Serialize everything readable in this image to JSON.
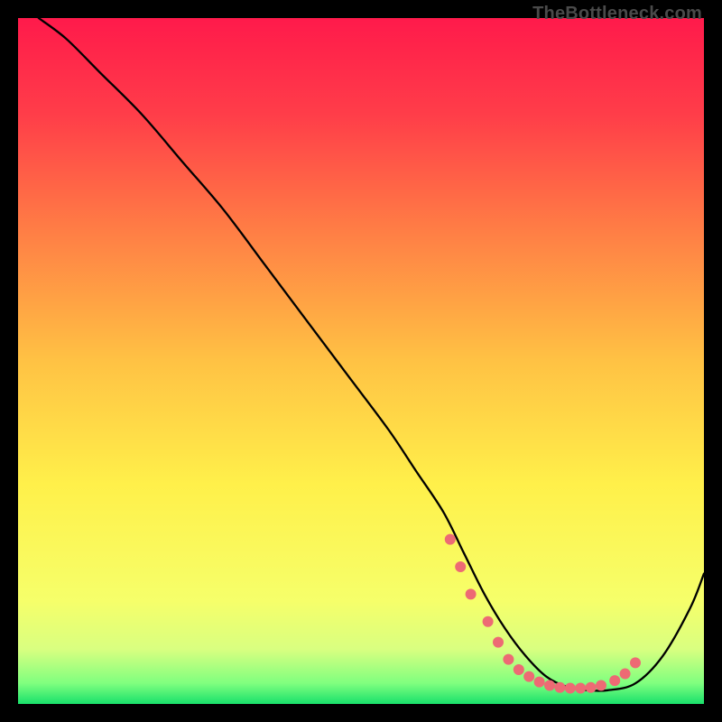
{
  "watermark": "TheBottleneck.com",
  "chart_data": {
    "type": "line",
    "title": "",
    "xlabel": "",
    "ylabel": "",
    "xlim": [
      0,
      100
    ],
    "ylim": [
      0,
      100
    ],
    "grid": false,
    "legend": false,
    "annotations": [],
    "gradient_stops": [
      {
        "pct": 0,
        "color": "#ff1a4b"
      },
      {
        "pct": 14,
        "color": "#ff3d49"
      },
      {
        "pct": 30,
        "color": "#ff7a45"
      },
      {
        "pct": 50,
        "color": "#ffc244"
      },
      {
        "pct": 68,
        "color": "#fff04a"
      },
      {
        "pct": 85,
        "color": "#f6ff6a"
      },
      {
        "pct": 92,
        "color": "#d9ff80"
      },
      {
        "pct": 97,
        "color": "#7fff7f"
      },
      {
        "pct": 100,
        "color": "#19e06b"
      }
    ],
    "series": [
      {
        "name": "bottleneck-curve",
        "color": "#000000",
        "width": 2.3,
        "x": [
          3,
          7,
          12,
          18,
          24,
          30,
          36,
          42,
          48,
          54,
          58,
          62,
          65,
          68,
          71,
          74,
          77,
          80,
          83,
          86,
          90,
          94,
          98,
          100
        ],
        "y": [
          100,
          97,
          92,
          86,
          79,
          72,
          64,
          56,
          48,
          40,
          34,
          28,
          22,
          16,
          11,
          7,
          4,
          2.5,
          2,
          2,
          3,
          7,
          14,
          19
        ]
      },
      {
        "name": "valley-dots",
        "color": "#ed6a74",
        "type": "scatter",
        "marker_size": 6,
        "x": [
          63,
          64.5,
          66,
          68.5,
          70,
          71.5,
          73,
          74.5,
          76,
          77.5,
          79,
          80.5,
          82,
          83.5,
          85,
          87,
          88.5,
          90
        ],
        "y": [
          24,
          20,
          16,
          12,
          9,
          6.5,
          5,
          4,
          3.2,
          2.7,
          2.4,
          2.3,
          2.3,
          2.4,
          2.7,
          3.4,
          4.4,
          6
        ]
      }
    ]
  }
}
